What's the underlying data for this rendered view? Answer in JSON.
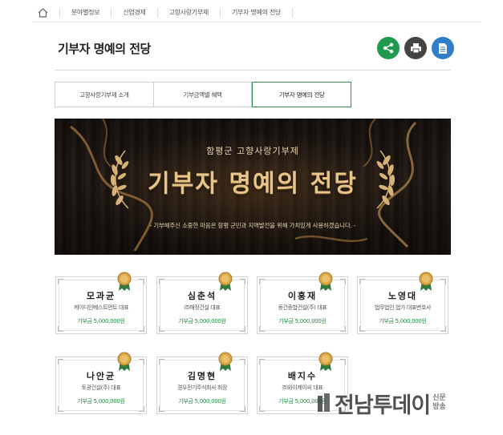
{
  "nav": {
    "items": [
      "분야별정보",
      "산업경제",
      "고향사랑기부제",
      "기부자 명예의 전당"
    ]
  },
  "header": {
    "title": "기부자 명예의 전당"
  },
  "actions": {
    "share_icon": "share-icon",
    "print_icon": "print-icon",
    "doc_icon": "document-icon",
    "colors": {
      "share": "#1f9a4e",
      "print": "#444444",
      "doc": "#2f7fc8"
    }
  },
  "tabs": [
    {
      "label": "고향사랑기부제 소개",
      "active": false
    },
    {
      "label": "기부금액별 혜택",
      "active": false
    },
    {
      "label": "기부자 명예의 전당",
      "active": true
    }
  ],
  "banner": {
    "subtitle": "함평군 고향사랑기부제",
    "title": "기부자 명예의 전당",
    "caption": "- 기부해주신 소중한 마음은 함평 군민과 지역발전을 위해 가치있게 사용하겠습니다. -"
  },
  "donors": [
    {
      "name": "모과균",
      "org": "케이디인베스트먼트 대표",
      "amount": "기부금 5,000,000원"
    },
    {
      "name": "심춘석",
      "org": "㈜해정건설 대표",
      "amount": "기부금 5,000,000원"
    },
    {
      "name": "이흥재",
      "org": "동건종합건설(주) 대표",
      "amount": "기부금 5,000,000원"
    },
    {
      "name": "노영대",
      "org": "법무법인 법가 대표변호사",
      "amount": "기부금 5,000,000원"
    },
    {
      "name": "나안균",
      "org": "토광건설(주) 대표",
      "amount": "기부금 5,000,000원"
    },
    {
      "name": "김명현",
      "org": "경우전기주식회사 회장",
      "amount": "기부금 5,000,000원"
    },
    {
      "name": "배지수",
      "org": "㈜와이제이씨 대표",
      "amount": "기부금 5,000,000원"
    }
  ],
  "watermark": {
    "text": "전남투데이",
    "side": [
      "신문",
      "방송"
    ]
  },
  "theme": {
    "accent": "#1f8a3e",
    "banner_gold": "#e8c488"
  }
}
